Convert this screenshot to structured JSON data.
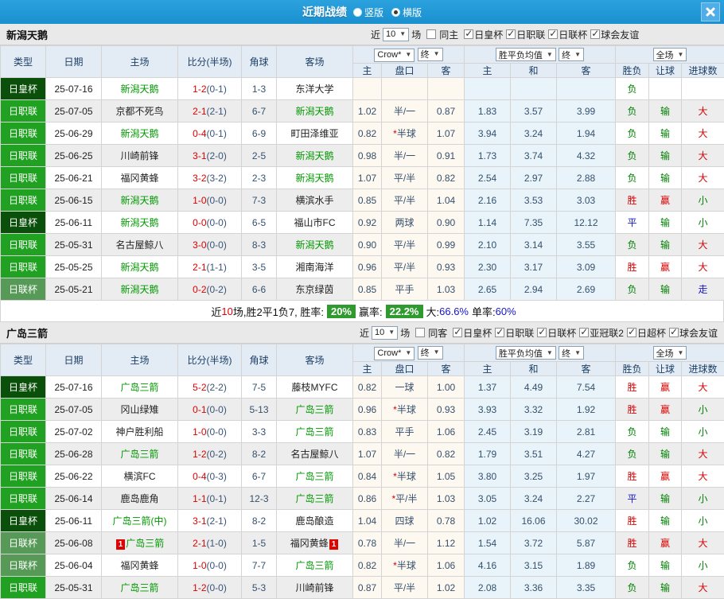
{
  "titlebar": {
    "title": "近期战绩",
    "options": [
      {
        "label": "竖版",
        "checked": false
      },
      {
        "label": "横版",
        "checked": true
      }
    ]
  },
  "colors": {
    "titlebar_blue": "#1e98d7",
    "cup_badge_green": "#0a4f0a",
    "league_badge_green": "#21a121",
    "league_cup_badge_green": "#579a57",
    "team_green": "#009900",
    "win_red": "#d90000",
    "lose_green": "#008000",
    "draw_blue": "#1515cc",
    "score_red": "#e00000",
    "rate_badge_green": "#2f9b2f",
    "odds_col_cream": "#fdf8f0",
    "avg_col_blue": "#e9f4fa"
  },
  "table_columns": [
    "类型",
    "日期",
    "主场",
    "比分(半场)",
    "角球",
    "客场",
    "主",
    "盘口",
    "客",
    "主",
    "和",
    "客",
    "胜负",
    "让球",
    "进球数"
  ],
  "sections": [
    {
      "team": "新潟天鹅",
      "filters": {
        "near": "近",
        "count": "10",
        "games": "场",
        "same": "同主",
        "same_checked": false,
        "leagues": [
          {
            "label": "日皇杯",
            "checked": true
          },
          {
            "label": "日职联",
            "checked": true
          },
          {
            "label": "日联杯",
            "checked": true
          },
          {
            "label": "球会友谊",
            "checked": true
          }
        ]
      },
      "dropdowns": {
        "book": "Crow*",
        "book_final": "终",
        "avg": "胜平负均值",
        "avg_final": "终",
        "scope": "全场"
      },
      "rows": [
        {
          "type": "日皇杯",
          "style": "cup",
          "date": "25-07-16",
          "home": "新潟天鹅",
          "hg": true,
          "hb": "",
          "score": "1-2",
          "half": "(0-1)",
          "corners": "1-3",
          "away": "东洋大学",
          "ag": false,
          "ab": "",
          "odds": [
            "",
            "",
            ""
          ],
          "avg": [
            "",
            "",
            ""
          ],
          "res": [
            [
              "负",
              "green"
            ],
            [
              "",
              ""
            ],
            [
              "",
              ""
            ]
          ]
        },
        {
          "type": "日职联",
          "style": "league",
          "date": "25-07-05",
          "home": "京都不死鸟",
          "hg": false,
          "hb": "",
          "score": "2-1",
          "half": "(2-1)",
          "corners": "6-7",
          "away": "新潟天鹅",
          "ag": true,
          "ab": "",
          "odds": [
            "1.02",
            "半/一",
            "0.87"
          ],
          "avg": [
            "1.83",
            "3.57",
            "3.99"
          ],
          "res": [
            [
              "负",
              "green"
            ],
            [
              "输",
              "green"
            ],
            [
              "大",
              "red"
            ]
          ]
        },
        {
          "type": "日职联",
          "style": "league",
          "date": "25-06-29",
          "home": "新潟天鹅",
          "hg": true,
          "hb": "",
          "score": "0-4",
          "half": "(0-1)",
          "corners": "6-9",
          "away": "町田泽维亚",
          "ag": false,
          "ab": "",
          "odds": [
            "0.82",
            "*半球",
            "1.07"
          ],
          "avg": [
            "3.94",
            "3.24",
            "1.94"
          ],
          "res": [
            [
              "负",
              "green"
            ],
            [
              "输",
              "green"
            ],
            [
              "大",
              "red"
            ]
          ]
        },
        {
          "type": "日职联",
          "style": "league",
          "date": "25-06-25",
          "home": "川崎前锋",
          "hg": false,
          "hb": "",
          "score": "3-1",
          "half": "(2-0)",
          "corners": "2-5",
          "away": "新潟天鹅",
          "ag": true,
          "ab": "",
          "odds": [
            "0.98",
            "半/一",
            "0.91"
          ],
          "avg": [
            "1.73",
            "3.74",
            "4.32"
          ],
          "res": [
            [
              "负",
              "green"
            ],
            [
              "输",
              "green"
            ],
            [
              "大",
              "red"
            ]
          ]
        },
        {
          "type": "日职联",
          "style": "league",
          "date": "25-06-21",
          "home": "福冈黄蜂",
          "hg": false,
          "hb": "",
          "score": "3-2",
          "half": "(3-2)",
          "corners": "2-3",
          "away": "新潟天鹅",
          "ag": true,
          "ab": "",
          "odds": [
            "1.07",
            "平/半",
            "0.82"
          ],
          "avg": [
            "2.54",
            "2.97",
            "2.88"
          ],
          "res": [
            [
              "负",
              "green"
            ],
            [
              "输",
              "green"
            ],
            [
              "大",
              "red"
            ]
          ]
        },
        {
          "type": "日职联",
          "style": "league",
          "date": "25-06-15",
          "home": "新潟天鹅",
          "hg": true,
          "hb": "",
          "score": "1-0",
          "half": "(0-0)",
          "corners": "7-3",
          "away": "横滨水手",
          "ag": false,
          "ab": "",
          "odds": [
            "0.85",
            "平/半",
            "1.04"
          ],
          "avg": [
            "2.16",
            "3.53",
            "3.03"
          ],
          "res": [
            [
              "胜",
              "red"
            ],
            [
              "赢",
              "red"
            ],
            [
              "小",
              "green"
            ]
          ]
        },
        {
          "type": "日皇杯",
          "style": "cup",
          "date": "25-06-11",
          "home": "新潟天鹅",
          "hg": true,
          "hb": "",
          "score": "0-0",
          "half": "(0-0)",
          "corners": "6-5",
          "away": "福山市FC",
          "ag": false,
          "ab": "",
          "odds": [
            "0.92",
            "两球",
            "0.90"
          ],
          "avg": [
            "1.14",
            "7.35",
            "12.12"
          ],
          "res": [
            [
              "平",
              "blue"
            ],
            [
              "输",
              "green"
            ],
            [
              "小",
              "green"
            ]
          ]
        },
        {
          "type": "日职联",
          "style": "league",
          "date": "25-05-31",
          "home": "名古屋鲸八",
          "hg": false,
          "hb": "",
          "score": "3-0",
          "half": "(0-0)",
          "corners": "8-3",
          "away": "新潟天鹅",
          "ag": true,
          "ab": "",
          "odds": [
            "0.90",
            "平/半",
            "0.99"
          ],
          "avg": [
            "2.10",
            "3.14",
            "3.55"
          ],
          "res": [
            [
              "负",
              "green"
            ],
            [
              "输",
              "green"
            ],
            [
              "大",
              "red"
            ]
          ]
        },
        {
          "type": "日职联",
          "style": "league",
          "date": "25-05-25",
          "home": "新潟天鹅",
          "hg": true,
          "hb": "",
          "score": "2-1",
          "half": "(1-1)",
          "corners": "3-5",
          "away": "湘南海洋",
          "ag": false,
          "ab": "",
          "odds": [
            "0.96",
            "平/半",
            "0.93"
          ],
          "avg": [
            "2.30",
            "3.17",
            "3.09"
          ],
          "res": [
            [
              "胜",
              "red"
            ],
            [
              "赢",
              "red"
            ],
            [
              "大",
              "red"
            ]
          ]
        },
        {
          "type": "日联杯",
          "style": "lcup",
          "date": "25-05-21",
          "home": "新潟天鹅",
          "hg": true,
          "hb": "",
          "score": "0-2",
          "half": "(0-2)",
          "corners": "6-6",
          "away": "东京绿茵",
          "ag": false,
          "ab": "",
          "odds": [
            "0.85",
            "平手",
            "1.03"
          ],
          "avg": [
            "2.65",
            "2.94",
            "2.69"
          ],
          "res": [
            [
              "负",
              "green"
            ],
            [
              "输",
              "green"
            ],
            [
              "走",
              "blue"
            ]
          ]
        }
      ],
      "summary": {
        "t1": "近",
        "n": "10",
        "t2": "场,胜2平1负7, 胜率:",
        "v1": "20%",
        "t3": "赢率:",
        "v2": "22.2%",
        "t4": "大:",
        "v3": "66.6%",
        "t5": "单率:",
        "v4": "60%"
      }
    },
    {
      "team": "广岛三箭",
      "filters": {
        "near": "近",
        "count": "10",
        "games": "场",
        "same": "同客",
        "same_checked": false,
        "leagues": [
          {
            "label": "日皇杯",
            "checked": true
          },
          {
            "label": "日职联",
            "checked": true
          },
          {
            "label": "日联杯",
            "checked": true
          },
          {
            "label": "亚冠联2",
            "checked": true
          },
          {
            "label": "日超杯",
            "checked": true
          },
          {
            "label": "球会友谊",
            "checked": true
          }
        ]
      },
      "dropdowns": {
        "book": "Crow*",
        "book_final": "终",
        "avg": "胜平负均值",
        "avg_final": "终",
        "scope": "全场"
      },
      "rows": [
        {
          "type": "日皇杯",
          "style": "cup",
          "date": "25-07-16",
          "home": "广岛三箭",
          "hg": true,
          "hb": "",
          "score": "5-2",
          "half": "(2-2)",
          "corners": "7-5",
          "away": "藤枝MYFC",
          "ag": false,
          "ab": "",
          "odds": [
            "0.82",
            "一球",
            "1.00"
          ],
          "avg": [
            "1.37",
            "4.49",
            "7.54"
          ],
          "res": [
            [
              "胜",
              "red"
            ],
            [
              "赢",
              "red"
            ],
            [
              "大",
              "red"
            ]
          ]
        },
        {
          "type": "日职联",
          "style": "league",
          "date": "25-07-05",
          "home": "冈山绿雉",
          "hg": false,
          "hb": "",
          "score": "0-1",
          "half": "(0-0)",
          "corners": "5-13",
          "away": "广岛三箭",
          "ag": true,
          "ab": "",
          "odds": [
            "0.96",
            "*半球",
            "0.93"
          ],
          "avg": [
            "3.93",
            "3.32",
            "1.92"
          ],
          "res": [
            [
              "胜",
              "red"
            ],
            [
              "赢",
              "red"
            ],
            [
              "小",
              "green"
            ]
          ]
        },
        {
          "type": "日职联",
          "style": "league",
          "date": "25-07-02",
          "home": "神户胜利船",
          "hg": false,
          "hb": "",
          "score": "1-0",
          "half": "(0-0)",
          "corners": "3-3",
          "away": "广岛三箭",
          "ag": true,
          "ab": "",
          "odds": [
            "0.83",
            "平手",
            "1.06"
          ],
          "avg": [
            "2.45",
            "3.19",
            "2.81"
          ],
          "res": [
            [
              "负",
              "green"
            ],
            [
              "输",
              "green"
            ],
            [
              "小",
              "green"
            ]
          ]
        },
        {
          "type": "日职联",
          "style": "league",
          "date": "25-06-28",
          "home": "广岛三箭",
          "hg": true,
          "hb": "",
          "score": "1-2",
          "half": "(0-2)",
          "corners": "8-2",
          "away": "名古屋鲸八",
          "ag": false,
          "ab": "",
          "odds": [
            "1.07",
            "半/一",
            "0.82"
          ],
          "avg": [
            "1.79",
            "3.51",
            "4.27"
          ],
          "res": [
            [
              "负",
              "green"
            ],
            [
              "输",
              "green"
            ],
            [
              "大",
              "red"
            ]
          ]
        },
        {
          "type": "日职联",
          "style": "league",
          "date": "25-06-22",
          "home": "横滨FC",
          "hg": false,
          "hb": "",
          "score": "0-4",
          "half": "(0-3)",
          "corners": "6-7",
          "away": "广岛三箭",
          "ag": true,
          "ab": "",
          "odds": [
            "0.84",
            "*半球",
            "1.05"
          ],
          "avg": [
            "3.80",
            "3.25",
            "1.97"
          ],
          "res": [
            [
              "胜",
              "red"
            ],
            [
              "赢",
              "red"
            ],
            [
              "大",
              "red"
            ]
          ]
        },
        {
          "type": "日职联",
          "style": "league",
          "date": "25-06-14",
          "home": "鹿岛鹿角",
          "hg": false,
          "hb": "",
          "score": "1-1",
          "half": "(0-1)",
          "corners": "12-3",
          "away": "广岛三箭",
          "ag": true,
          "ab": "",
          "odds": [
            "0.86",
            "*平/半",
            "1.03"
          ],
          "avg": [
            "3.05",
            "3.24",
            "2.27"
          ],
          "res": [
            [
              "平",
              "blue"
            ],
            [
              "输",
              "green"
            ],
            [
              "小",
              "green"
            ]
          ]
        },
        {
          "type": "日皇杯",
          "style": "cup",
          "date": "25-06-11",
          "home": "广岛三箭(中)",
          "hg": true,
          "hb": "",
          "score": "3-1",
          "half": "(2-1)",
          "corners": "8-2",
          "away": "鹿岛酿造",
          "ag": false,
          "ab": "",
          "odds": [
            "1.04",
            "四球",
            "0.78"
          ],
          "avg": [
            "1.02",
            "16.06",
            "30.02"
          ],
          "res": [
            [
              "胜",
              "red"
            ],
            [
              "输",
              "green"
            ],
            [
              "小",
              "green"
            ]
          ]
        },
        {
          "type": "日联杯",
          "style": "lcup",
          "date": "25-06-08",
          "home": "广岛三箭",
          "hg": true,
          "hb": "1",
          "score": "2-1",
          "half": "(1-0)",
          "corners": "1-5",
          "away": "福冈黄蜂",
          "ag": false,
          "ab": "1",
          "odds": [
            "0.78",
            "半/一",
            "1.12"
          ],
          "avg": [
            "1.54",
            "3.72",
            "5.87"
          ],
          "res": [
            [
              "胜",
              "red"
            ],
            [
              "赢",
              "red"
            ],
            [
              "大",
              "red"
            ]
          ]
        },
        {
          "type": "日联杯",
          "style": "lcup",
          "date": "25-06-04",
          "home": "福冈黄蜂",
          "hg": false,
          "hb": "",
          "score": "1-0",
          "half": "(0-0)",
          "corners": "7-7",
          "away": "广岛三箭",
          "ag": true,
          "ab": "",
          "odds": [
            "0.82",
            "*半球",
            "1.06"
          ],
          "avg": [
            "4.16",
            "3.15",
            "1.89"
          ],
          "res": [
            [
              "负",
              "green"
            ],
            [
              "输",
              "green"
            ],
            [
              "小",
              "green"
            ]
          ]
        },
        {
          "type": "日职联",
          "style": "league",
          "date": "25-05-31",
          "home": "广岛三箭",
          "hg": true,
          "hb": "",
          "score": "1-2",
          "half": "(0-0)",
          "corners": "5-3",
          "away": "川崎前锋",
          "ag": false,
          "ab": "",
          "odds": [
            "0.87",
            "平/半",
            "1.02"
          ],
          "avg": [
            "2.08",
            "3.36",
            "3.35"
          ],
          "res": [
            [
              "负",
              "green"
            ],
            [
              "输",
              "green"
            ],
            [
              "大",
              "red"
            ]
          ]
        }
      ]
    }
  ]
}
